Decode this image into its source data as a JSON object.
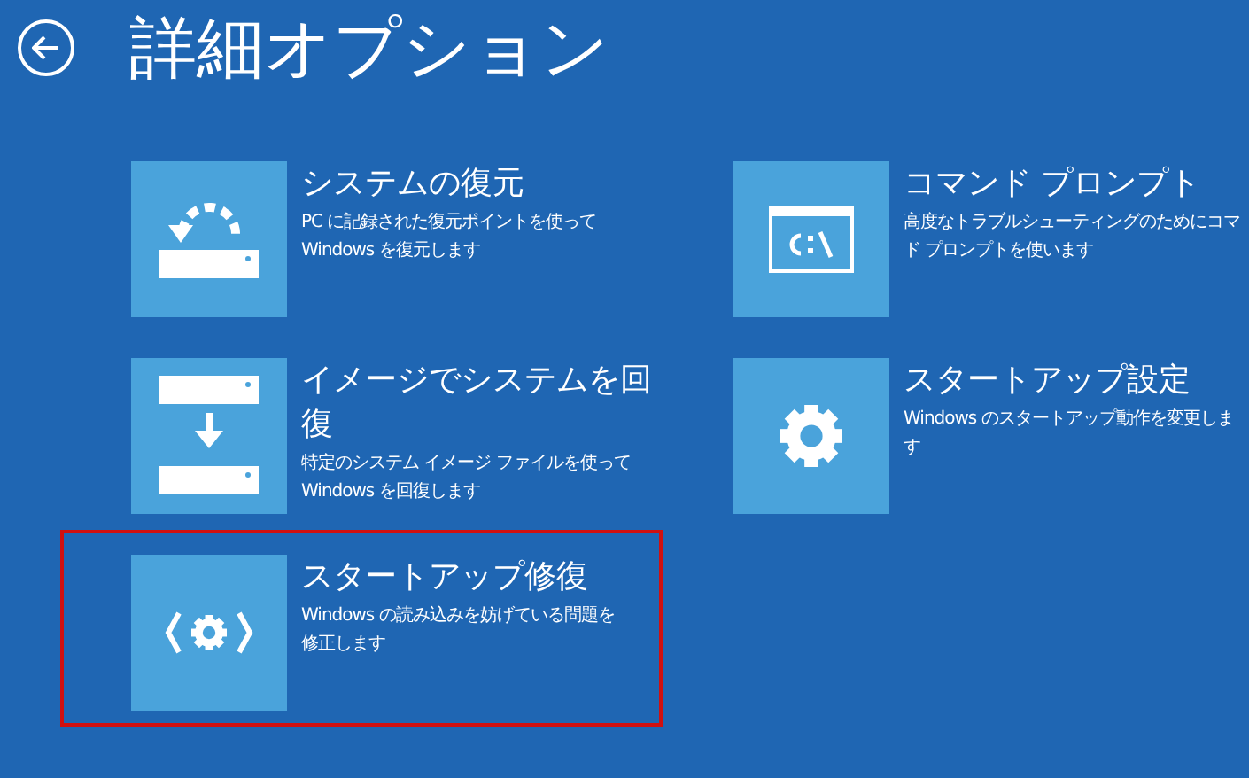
{
  "header": {
    "title": "詳細オプション"
  },
  "options": [
    {
      "kind": "restore",
      "title_lines": [
        "システムの復元"
      ],
      "description_lines": [
        "PC に記録された復元ポイントを使って",
        "Windows を復元します"
      ],
      "selected": false
    },
    {
      "kind": "command",
      "title_lines": [
        "コマンド プロンプト"
      ],
      "description_lines": [
        "高度なトラブルシューティングのためにコマ",
        "ド プロンプトを使います"
      ],
      "selected": false
    },
    {
      "kind": "image",
      "title_lines": [
        "イメージでシステムを回",
        "復"
      ],
      "description_lines": [
        "特定のシステム イメージ ファイルを使って",
        "Windows を回復します"
      ],
      "selected": false
    },
    {
      "kind": "settings",
      "title_lines": [
        "スタートアップ設定"
      ],
      "description_lines": [
        "Windows のスタートアップ動作を変更しま",
        "す"
      ],
      "selected": false
    },
    {
      "kind": "repair",
      "title_lines": [
        "スタートアップ修復"
      ],
      "description_lines": [
        "Windows の読み込みを妨げている問題を",
        "修正します"
      ],
      "selected": true
    }
  ]
}
